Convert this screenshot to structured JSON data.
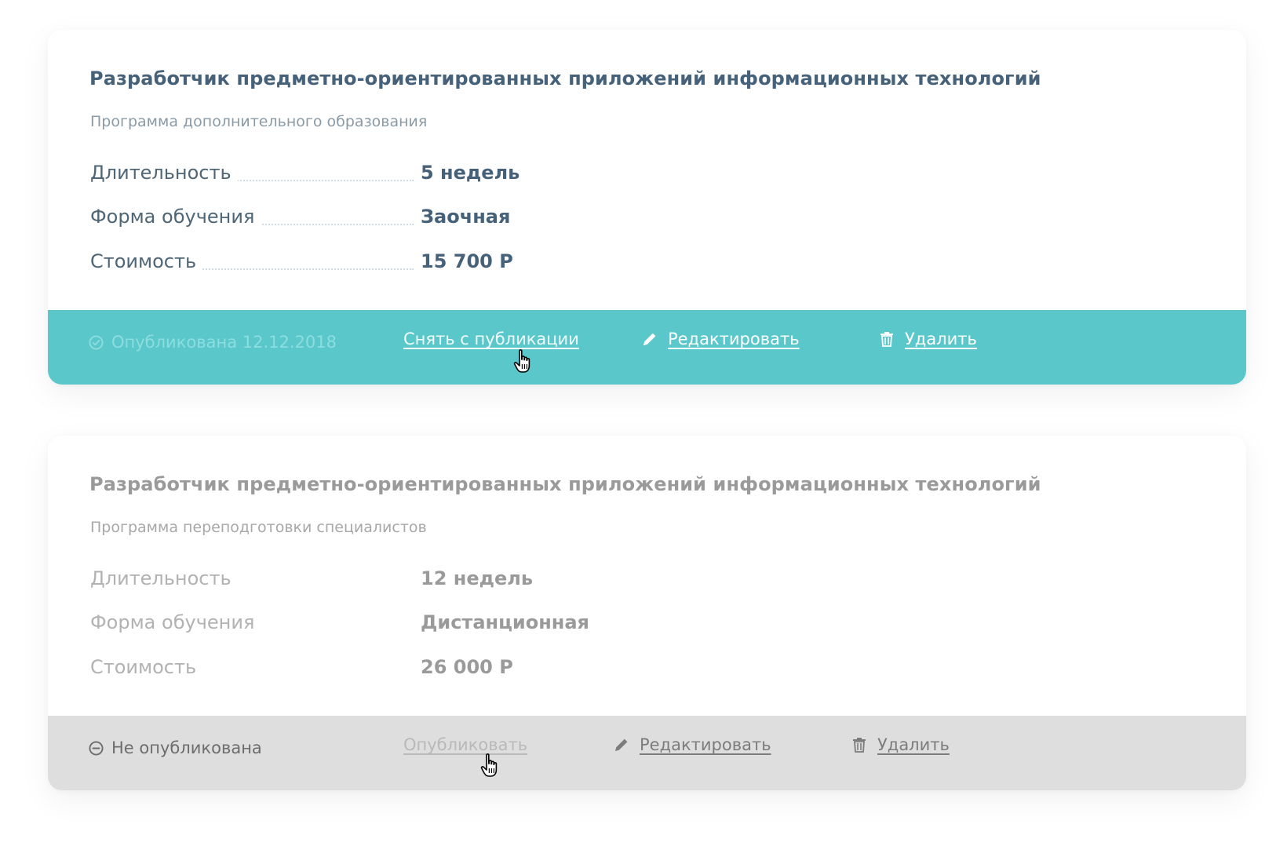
{
  "cards": [
    {
      "title": "Разработчик предметно-ориентированных приложений информационных технологий",
      "subtitle": "Программа дополнительного образования",
      "rows": [
        {
          "label": "Длительность",
          "value": "5 недель"
        },
        {
          "label": "Форма обучения",
          "value": "Заочная"
        },
        {
          "label": "Стоимость",
          "value": "15 700 Р"
        }
      ],
      "footer": {
        "status_text": "Опубликована 12.12.2018",
        "status_icon": "check-circle-icon",
        "toggle_label": "Снять с публикации",
        "edit_label": "Редактировать",
        "delete_label": "Удалить",
        "background": "#5ac8cb"
      }
    },
    {
      "title": "Разработчик предметно-ориентированных приложений информационных технологий",
      "subtitle": "Программа переподготовки специалистов",
      "rows": [
        {
          "label": "Длительность",
          "value": "12 недель"
        },
        {
          "label": "Форма обучения",
          "value": "Дистанционная"
        },
        {
          "label": "Стоимость",
          "value": "26 000 Р"
        }
      ],
      "footer": {
        "status_text": "Не опубликована",
        "status_icon": "minus-circle-icon",
        "toggle_label": "Опубликовать",
        "edit_label": "Редактировать",
        "delete_label": "Удалить",
        "background": "#dedede"
      }
    }
  ],
  "icons": {
    "edit": "pencil-icon",
    "delete": "trash-icon",
    "cursor": "hand-pointer-icon"
  }
}
